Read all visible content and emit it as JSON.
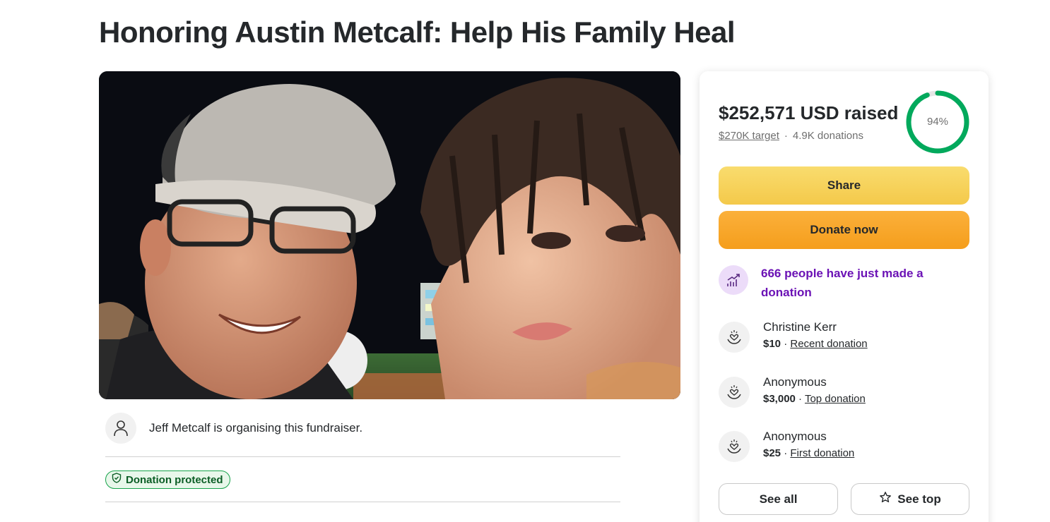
{
  "page": {
    "title": "Honoring Austin Metcalf: Help His Family Heal"
  },
  "organiser": {
    "text": "Jeff Metcalf is organising this fundraiser.",
    "icon": "user-icon"
  },
  "badge": {
    "label": "Donation protected",
    "icon": "shield-check-icon",
    "color": "#16a34a"
  },
  "stats": {
    "raised": "$252,571 USD raised",
    "target": "$270K target",
    "separator": "·",
    "donations": "4.9K donations",
    "progress_label": "94%",
    "progress_fraction": 0.94,
    "ring_color": "#02a95c"
  },
  "buttons": {
    "share": "Share",
    "donate": "Donate now",
    "see_all": "See all",
    "see_top": "See top"
  },
  "activity": {
    "text": "666 people have just made a donation",
    "icon": "trending-up-icon",
    "color": "#6b12b5"
  },
  "donors": [
    {
      "name": "Christine Kerr",
      "amount": "$10",
      "sep": " · ",
      "kind": "Recent donation"
    },
    {
      "name": "Anonymous",
      "amount": "$3,000",
      "sep": " · ",
      "kind": "Top donation"
    },
    {
      "name": "Anonymous",
      "amount": "$25",
      "sep": " · ",
      "kind": "First donation"
    }
  ]
}
